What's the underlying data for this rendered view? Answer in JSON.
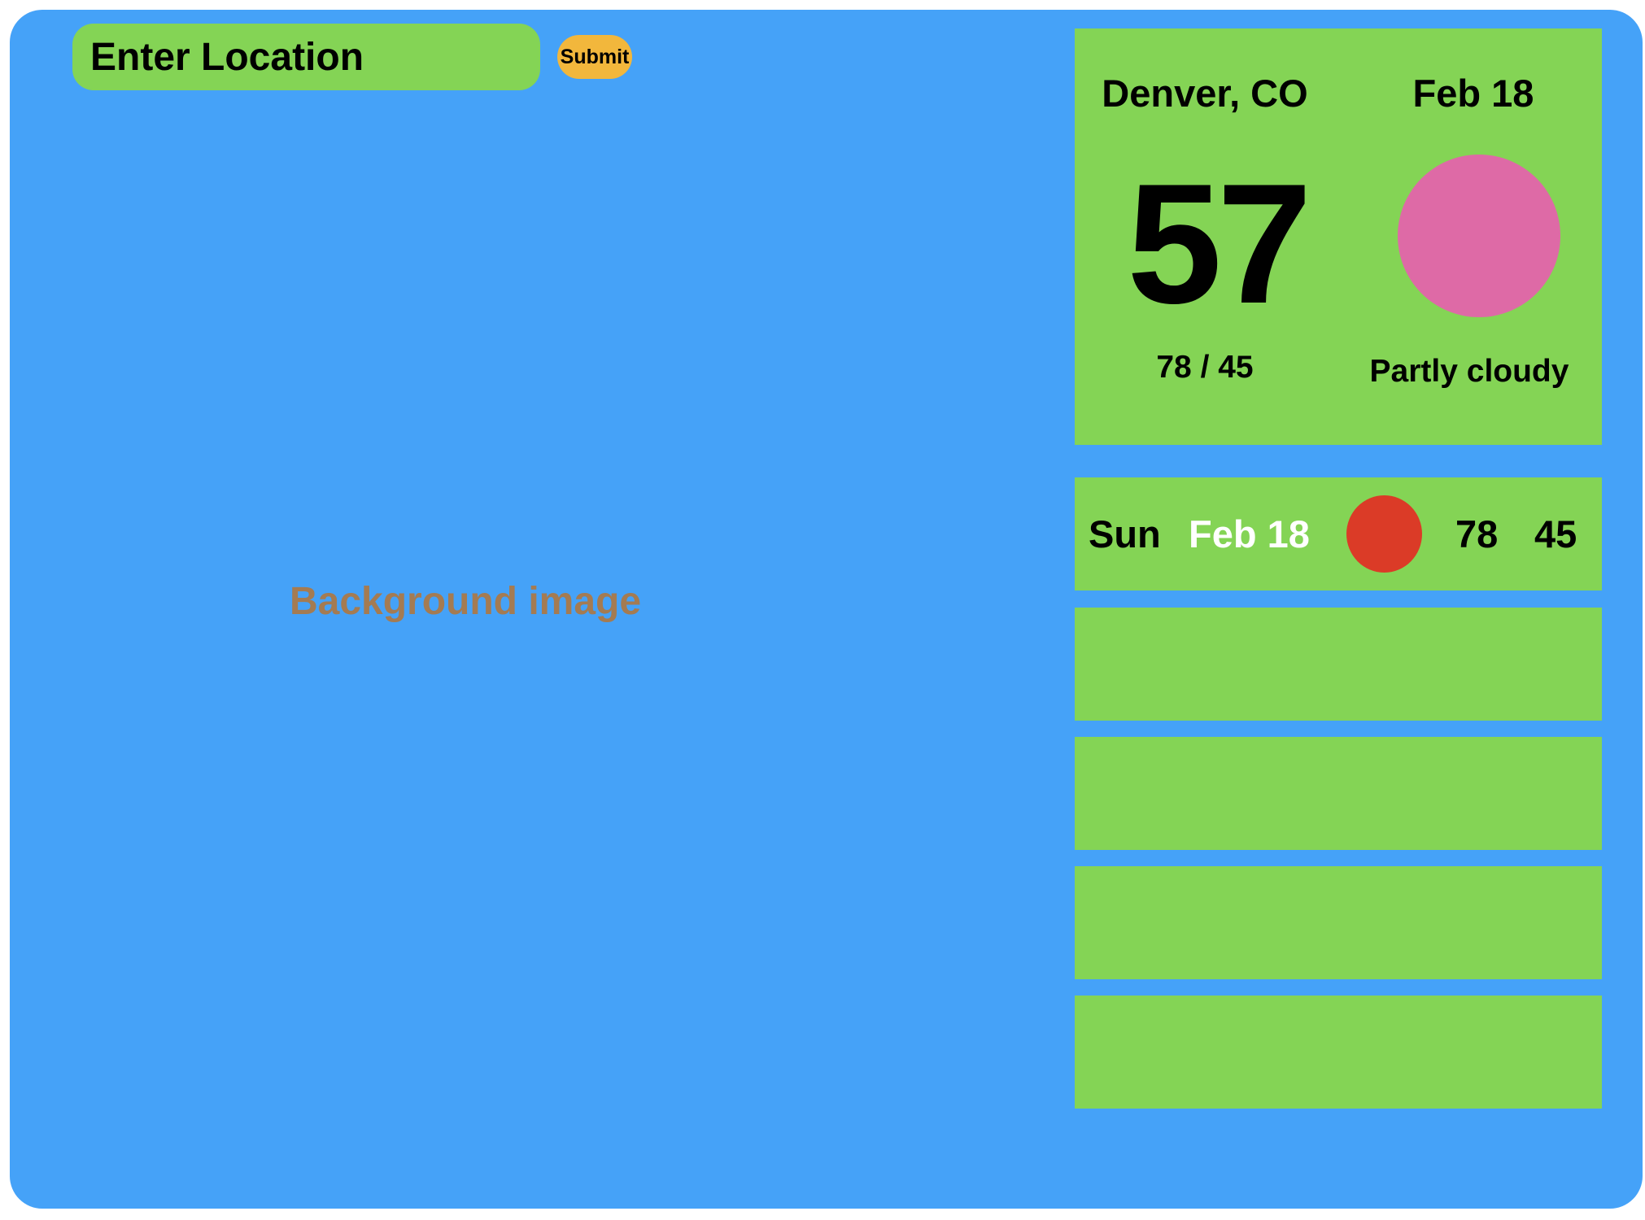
{
  "search": {
    "placeholder": "Enter Location",
    "submit_label": "Submit"
  },
  "background": {
    "label": "Background image"
  },
  "current": {
    "location": "Denver, CO",
    "date": "Feb 18",
    "temperature": "57",
    "hi_lo": "78 / 45",
    "condition": "Partly cloudy",
    "icon": "weather-condition-icon",
    "icon_color": "#de6aa6"
  },
  "forecast": [
    {
      "day": "Sun",
      "date": "Feb 18",
      "hi": "78",
      "lo": "45",
      "icon": "weather-icon",
      "icon_color": "#db3b27"
    },
    {
      "day": "",
      "date": "",
      "hi": "",
      "lo": ""
    },
    {
      "day": "",
      "date": "",
      "hi": "",
      "lo": ""
    },
    {
      "day": "",
      "date": "",
      "hi": "",
      "lo": ""
    },
    {
      "day": "",
      "date": "",
      "hi": "",
      "lo": ""
    }
  ],
  "colors": {
    "app_background": "#45a2f8",
    "card": "#84d455",
    "submit": "#f2b73c",
    "background_label": "#a47b52"
  }
}
